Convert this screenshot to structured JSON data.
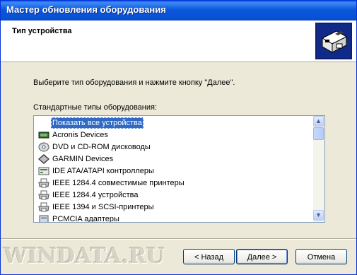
{
  "window": {
    "title": "Мастер обновления оборудования"
  },
  "header": {
    "title": "Тип устройства"
  },
  "instruction": "Выберите тип оборудования и нажмите кнопку \"Далее\".",
  "list": {
    "label": "Стандартные типы оборудования:",
    "items": [
      {
        "label": "Показать все устройства",
        "icon": "none",
        "selected": true
      },
      {
        "label": "Acronis Devices",
        "icon": "chip-icon"
      },
      {
        "label": "DVD и CD-ROM дисководы",
        "icon": "cdrom-icon"
      },
      {
        "label": "GARMIN Devices",
        "icon": "diamond-icon"
      },
      {
        "label": "IDE ATA/ATAPI контроллеры",
        "icon": "ide-controller-icon"
      },
      {
        "label": "IEEE 1284.4 совместимые принтеры",
        "icon": "printer-icon"
      },
      {
        "label": "IEEE 1284.4 устройства",
        "icon": "printer-icon"
      },
      {
        "label": "IEEE 1394 и SCSI-принтеры",
        "icon": "printer-icon"
      },
      {
        "label": "PCMCIA адаптеры",
        "icon": "pcmcia-icon"
      }
    ]
  },
  "buttons": {
    "back": "< Назад",
    "next": "Далее >",
    "cancel": "Отмена"
  },
  "watermark": "WINDATA.RU"
}
